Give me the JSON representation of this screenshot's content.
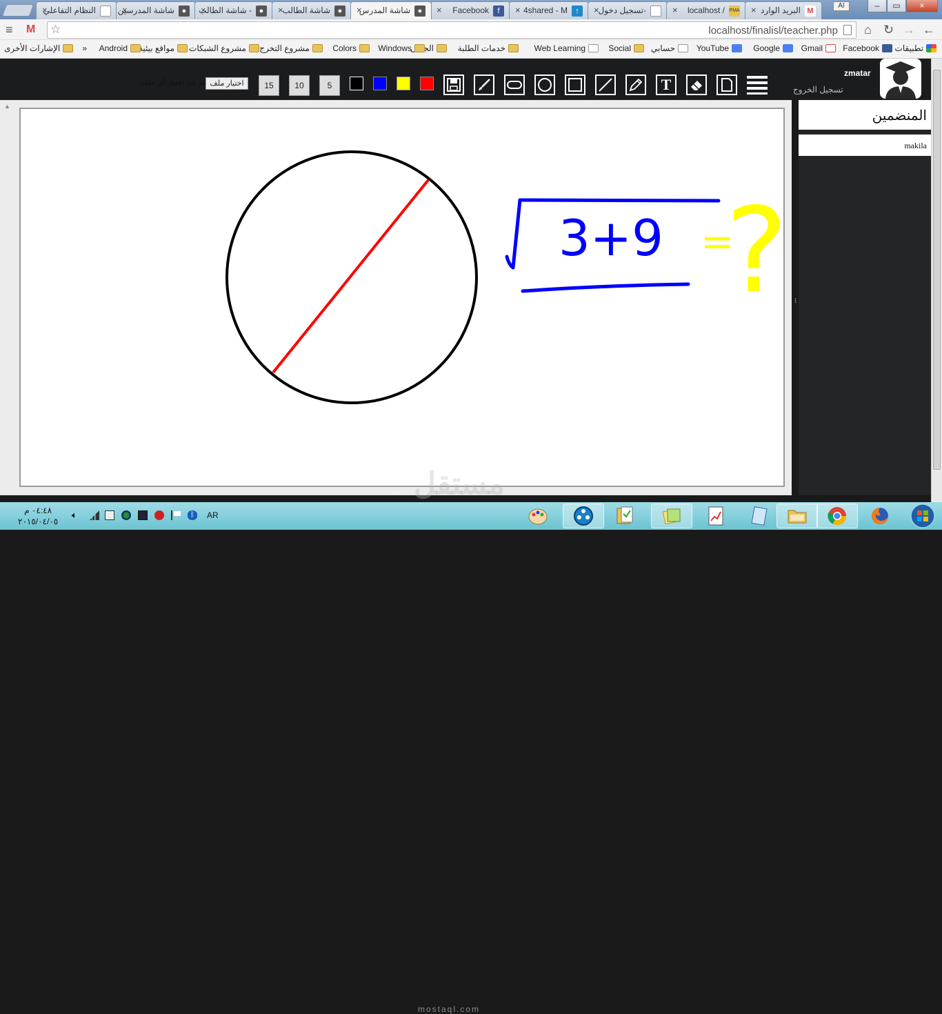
{
  "browser": {
    "tabs": [
      {
        "label": "النظام التفاعلي"
      },
      {
        "label": "شاشة المدرسين"
      },
      {
        "label": "شاشة الطالب -"
      },
      {
        "label": "شاشة الطالب"
      },
      {
        "label": "شاشة المدرس"
      },
      {
        "label": "Facebook"
      },
      {
        "label": "4shared - M"
      },
      {
        "label": "تسجيل دخول-"
      },
      {
        "label": "localhost /"
      },
      {
        "label": "البريد الوارد"
      }
    ],
    "profile_label": "AI",
    "url": "localhost/finalisl/teacher.php",
    "bookmarks": [
      {
        "label": "تطبيقات"
      },
      {
        "label": "Facebook"
      },
      {
        "label": "Gmail"
      },
      {
        "label": "Google"
      },
      {
        "label": "YouTube"
      },
      {
        "label": "حسابي"
      },
      {
        "label": "Social"
      },
      {
        "label": "Web Learning"
      },
      {
        "label": "خدمات الطلبة"
      },
      {
        "label": "الجمال"
      },
      {
        "label": "Windows"
      },
      {
        "label": "Colors"
      },
      {
        "label": "مشروع التخرج"
      },
      {
        "label": "مشروع الشبكات"
      },
      {
        "label": "مواقع بيئية"
      },
      {
        "label": "Android"
      },
      {
        "label": "»"
      },
      {
        "label": "الإشارات الأخرى"
      }
    ]
  },
  "app": {
    "username": "zmatar",
    "logout_label": "تسجيل الخروج",
    "file_button_label": "اختيار ملف",
    "file_status": "لم يتم اختيار أي ملف",
    "sizes": [
      "15",
      "10",
      "5"
    ],
    "colors": [
      "#000000",
      "#0000ff",
      "#ffff00",
      "#ff0000"
    ],
    "tools": [
      "save-icon",
      "brush-icon",
      "ellipse-icon",
      "circle-icon",
      "rectangle-icon",
      "line-icon",
      "pencil-icon",
      "text-icon",
      "eraser-icon",
      "page-icon",
      "menu-icon"
    ],
    "text_tool_glyph": "T",
    "side_title": "المنضمين",
    "members": [
      "makila"
    ]
  },
  "board": {
    "math_text": "3+9",
    "equals": "=",
    "question": "?"
  },
  "taskbar": {
    "language": "AR",
    "time": "٠٤:٤٨ م",
    "date": "٢٠١٥/٠٤/٠٥"
  },
  "watermark": {
    "text": "مستقل",
    "sub": "mostaql.com"
  }
}
